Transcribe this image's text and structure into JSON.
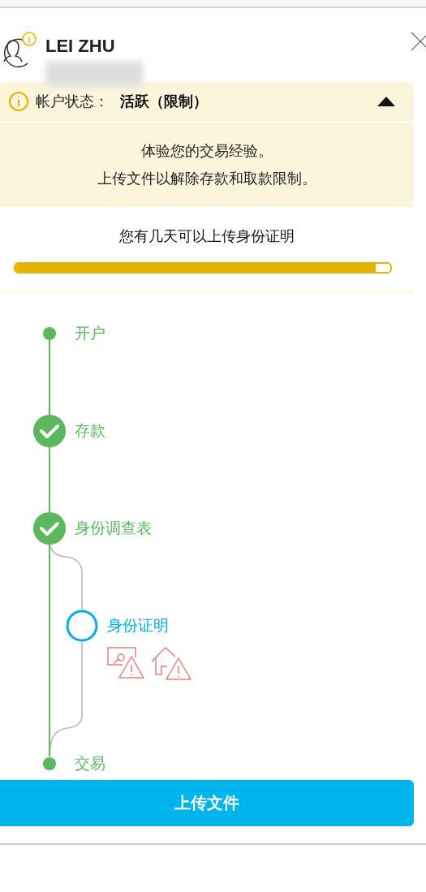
{
  "user": {
    "name": "LEI ZHU"
  },
  "account_status": {
    "label": "帐户状态：",
    "value": "活跃（限制）",
    "expanded": true,
    "message_lines": [
      "体验您的交易经验。",
      "上传文件以解除存款和取款限制。"
    ]
  },
  "deadline": {
    "text": "您有几天可以上传身份证明",
    "level": 0.96
  },
  "steps": [
    {
      "label": "开户",
      "kind": "point"
    },
    {
      "label": "存款",
      "kind": "check"
    },
    {
      "label": "身份调查表",
      "kind": "check",
      "children": [
        {
          "label": "身份证明",
          "kind": "pending"
        }
      ]
    },
    {
      "label": "交易",
      "kind": "point"
    }
  ],
  "upload_button": "上传文件"
}
